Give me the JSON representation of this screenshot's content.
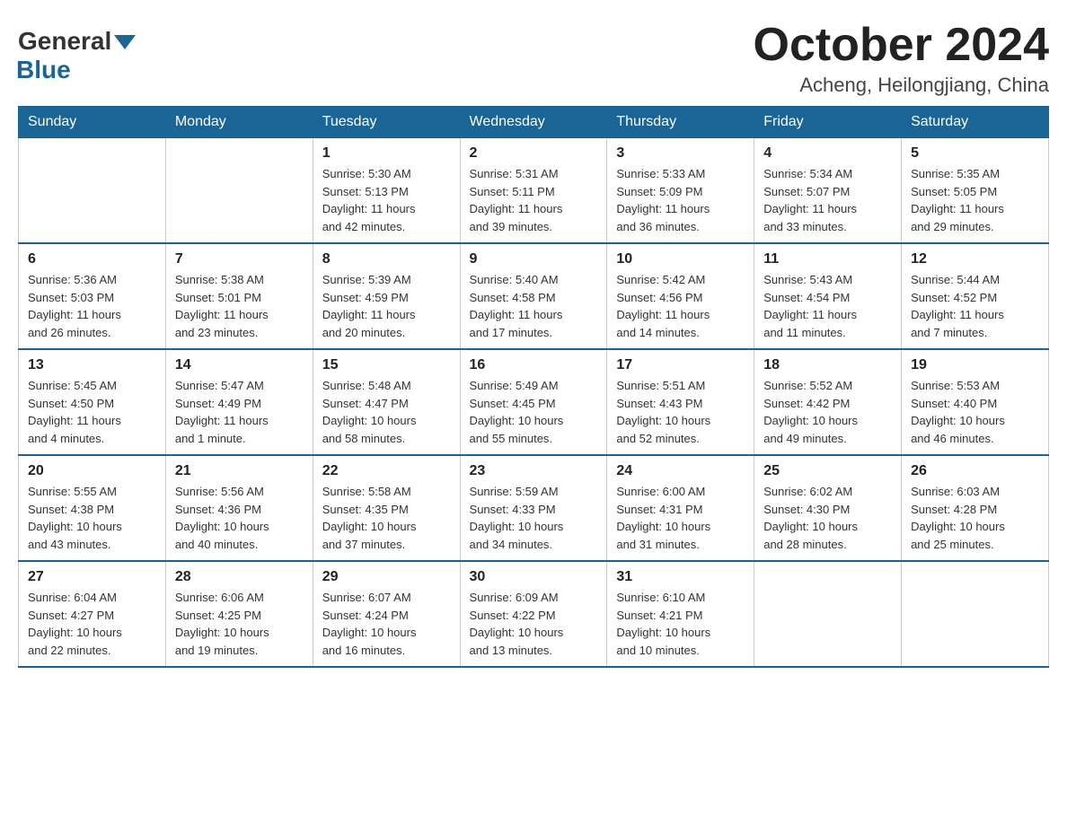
{
  "header": {
    "title": "October 2024",
    "location": "Acheng, Heilongjiang, China"
  },
  "logo": {
    "general": "General",
    "arrow": "",
    "blue": "Blue"
  },
  "days_of_week": [
    "Sunday",
    "Monday",
    "Tuesday",
    "Wednesday",
    "Thursday",
    "Friday",
    "Saturday"
  ],
  "weeks": [
    [
      {
        "day": "",
        "info": ""
      },
      {
        "day": "",
        "info": ""
      },
      {
        "day": "1",
        "info": "Sunrise: 5:30 AM\nSunset: 5:13 PM\nDaylight: 11 hours\nand 42 minutes."
      },
      {
        "day": "2",
        "info": "Sunrise: 5:31 AM\nSunset: 5:11 PM\nDaylight: 11 hours\nand 39 minutes."
      },
      {
        "day": "3",
        "info": "Sunrise: 5:33 AM\nSunset: 5:09 PM\nDaylight: 11 hours\nand 36 minutes."
      },
      {
        "day": "4",
        "info": "Sunrise: 5:34 AM\nSunset: 5:07 PM\nDaylight: 11 hours\nand 33 minutes."
      },
      {
        "day": "5",
        "info": "Sunrise: 5:35 AM\nSunset: 5:05 PM\nDaylight: 11 hours\nand 29 minutes."
      }
    ],
    [
      {
        "day": "6",
        "info": "Sunrise: 5:36 AM\nSunset: 5:03 PM\nDaylight: 11 hours\nand 26 minutes."
      },
      {
        "day": "7",
        "info": "Sunrise: 5:38 AM\nSunset: 5:01 PM\nDaylight: 11 hours\nand 23 minutes."
      },
      {
        "day": "8",
        "info": "Sunrise: 5:39 AM\nSunset: 4:59 PM\nDaylight: 11 hours\nand 20 minutes."
      },
      {
        "day": "9",
        "info": "Sunrise: 5:40 AM\nSunset: 4:58 PM\nDaylight: 11 hours\nand 17 minutes."
      },
      {
        "day": "10",
        "info": "Sunrise: 5:42 AM\nSunset: 4:56 PM\nDaylight: 11 hours\nand 14 minutes."
      },
      {
        "day": "11",
        "info": "Sunrise: 5:43 AM\nSunset: 4:54 PM\nDaylight: 11 hours\nand 11 minutes."
      },
      {
        "day": "12",
        "info": "Sunrise: 5:44 AM\nSunset: 4:52 PM\nDaylight: 11 hours\nand 7 minutes."
      }
    ],
    [
      {
        "day": "13",
        "info": "Sunrise: 5:45 AM\nSunset: 4:50 PM\nDaylight: 11 hours\nand 4 minutes."
      },
      {
        "day": "14",
        "info": "Sunrise: 5:47 AM\nSunset: 4:49 PM\nDaylight: 11 hours\nand 1 minute."
      },
      {
        "day": "15",
        "info": "Sunrise: 5:48 AM\nSunset: 4:47 PM\nDaylight: 10 hours\nand 58 minutes."
      },
      {
        "day": "16",
        "info": "Sunrise: 5:49 AM\nSunset: 4:45 PM\nDaylight: 10 hours\nand 55 minutes."
      },
      {
        "day": "17",
        "info": "Sunrise: 5:51 AM\nSunset: 4:43 PM\nDaylight: 10 hours\nand 52 minutes."
      },
      {
        "day": "18",
        "info": "Sunrise: 5:52 AM\nSunset: 4:42 PM\nDaylight: 10 hours\nand 49 minutes."
      },
      {
        "day": "19",
        "info": "Sunrise: 5:53 AM\nSunset: 4:40 PM\nDaylight: 10 hours\nand 46 minutes."
      }
    ],
    [
      {
        "day": "20",
        "info": "Sunrise: 5:55 AM\nSunset: 4:38 PM\nDaylight: 10 hours\nand 43 minutes."
      },
      {
        "day": "21",
        "info": "Sunrise: 5:56 AM\nSunset: 4:36 PM\nDaylight: 10 hours\nand 40 minutes."
      },
      {
        "day": "22",
        "info": "Sunrise: 5:58 AM\nSunset: 4:35 PM\nDaylight: 10 hours\nand 37 minutes."
      },
      {
        "day": "23",
        "info": "Sunrise: 5:59 AM\nSunset: 4:33 PM\nDaylight: 10 hours\nand 34 minutes."
      },
      {
        "day": "24",
        "info": "Sunrise: 6:00 AM\nSunset: 4:31 PM\nDaylight: 10 hours\nand 31 minutes."
      },
      {
        "day": "25",
        "info": "Sunrise: 6:02 AM\nSunset: 4:30 PM\nDaylight: 10 hours\nand 28 minutes."
      },
      {
        "day": "26",
        "info": "Sunrise: 6:03 AM\nSunset: 4:28 PM\nDaylight: 10 hours\nand 25 minutes."
      }
    ],
    [
      {
        "day": "27",
        "info": "Sunrise: 6:04 AM\nSunset: 4:27 PM\nDaylight: 10 hours\nand 22 minutes."
      },
      {
        "day": "28",
        "info": "Sunrise: 6:06 AM\nSunset: 4:25 PM\nDaylight: 10 hours\nand 19 minutes."
      },
      {
        "day": "29",
        "info": "Sunrise: 6:07 AM\nSunset: 4:24 PM\nDaylight: 10 hours\nand 16 minutes."
      },
      {
        "day": "30",
        "info": "Sunrise: 6:09 AM\nSunset: 4:22 PM\nDaylight: 10 hours\nand 13 minutes."
      },
      {
        "day": "31",
        "info": "Sunrise: 6:10 AM\nSunset: 4:21 PM\nDaylight: 10 hours\nand 10 minutes."
      },
      {
        "day": "",
        "info": ""
      },
      {
        "day": "",
        "info": ""
      }
    ]
  ]
}
